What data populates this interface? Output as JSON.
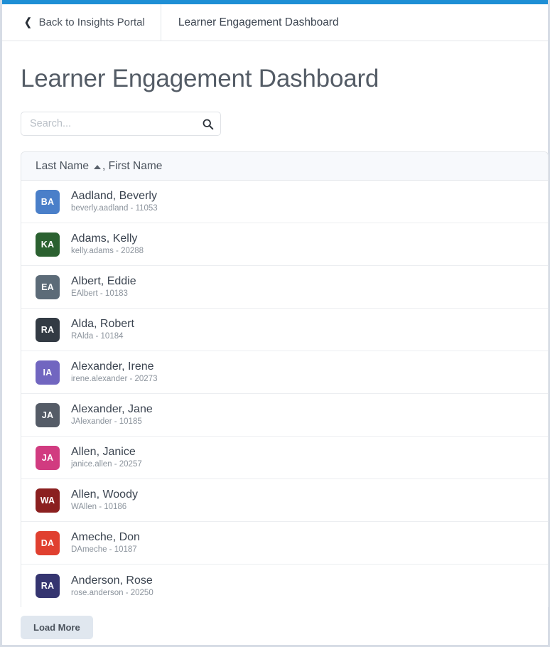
{
  "theme": {
    "accent_bar_color": "#1e8fd5",
    "page_background": "#ffffff",
    "frame_border_color": "#d6dce5",
    "header_row_background": "#f7f9fc",
    "divider_color": "#eceef1",
    "text_primary": "#3b4450",
    "text_secondary": "#8b939c"
  },
  "navbar": {
    "back_label": "Back to Insights Portal",
    "back_icon": "chevron-left-icon",
    "title": "Learner Engagement Dashboard"
  },
  "page": {
    "title": "Learner Engagement Dashboard"
  },
  "search": {
    "placeholder": "Search...",
    "value": "",
    "icon": "search-icon"
  },
  "table": {
    "column_header": {
      "primary_label": "Last Name",
      "sort_indicator": "ascending",
      "secondary_label": ", First Name"
    },
    "rows": [
      {
        "initials": "BA",
        "avatar_color": "#4a7fc9",
        "name": "Aadland, Beverly",
        "subtitle": "beverly.aadland - 11053"
      },
      {
        "initials": "KA",
        "avatar_color": "#2b6130",
        "name": "Adams, Kelly",
        "subtitle": "kelly.adams - 20288"
      },
      {
        "initials": "EA",
        "avatar_color": "#5c6b78",
        "name": "Albert, Eddie",
        "subtitle": "EAlbert - 10183"
      },
      {
        "initials": "RA",
        "avatar_color": "#333b44",
        "name": "Alda, Robert",
        "subtitle": "RAlda - 10184"
      },
      {
        "initials": "IA",
        "avatar_color": "#7166c0",
        "name": "Alexander, Irene",
        "subtitle": "irene.alexander - 20273"
      },
      {
        "initials": "JA",
        "avatar_color": "#555c67",
        "name": "Alexander, Jane",
        "subtitle": "JAlexander - 10185"
      },
      {
        "initials": "JA",
        "avatar_color": "#d13b80",
        "name": "Allen, Janice",
        "subtitle": "janice.allen - 20257"
      },
      {
        "initials": "WA",
        "avatar_color": "#8b2020",
        "name": "Allen, Woody",
        "subtitle": "WAllen - 10186"
      },
      {
        "initials": "DA",
        "avatar_color": "#e04030",
        "name": "Ameche, Don",
        "subtitle": "DAmeche - 10187"
      },
      {
        "initials": "RA",
        "avatar_color": "#353570",
        "name": "Anderson, Rose",
        "subtitle": "rose.anderson - 20250"
      }
    ]
  },
  "footer": {
    "load_more_label": "Load More"
  }
}
